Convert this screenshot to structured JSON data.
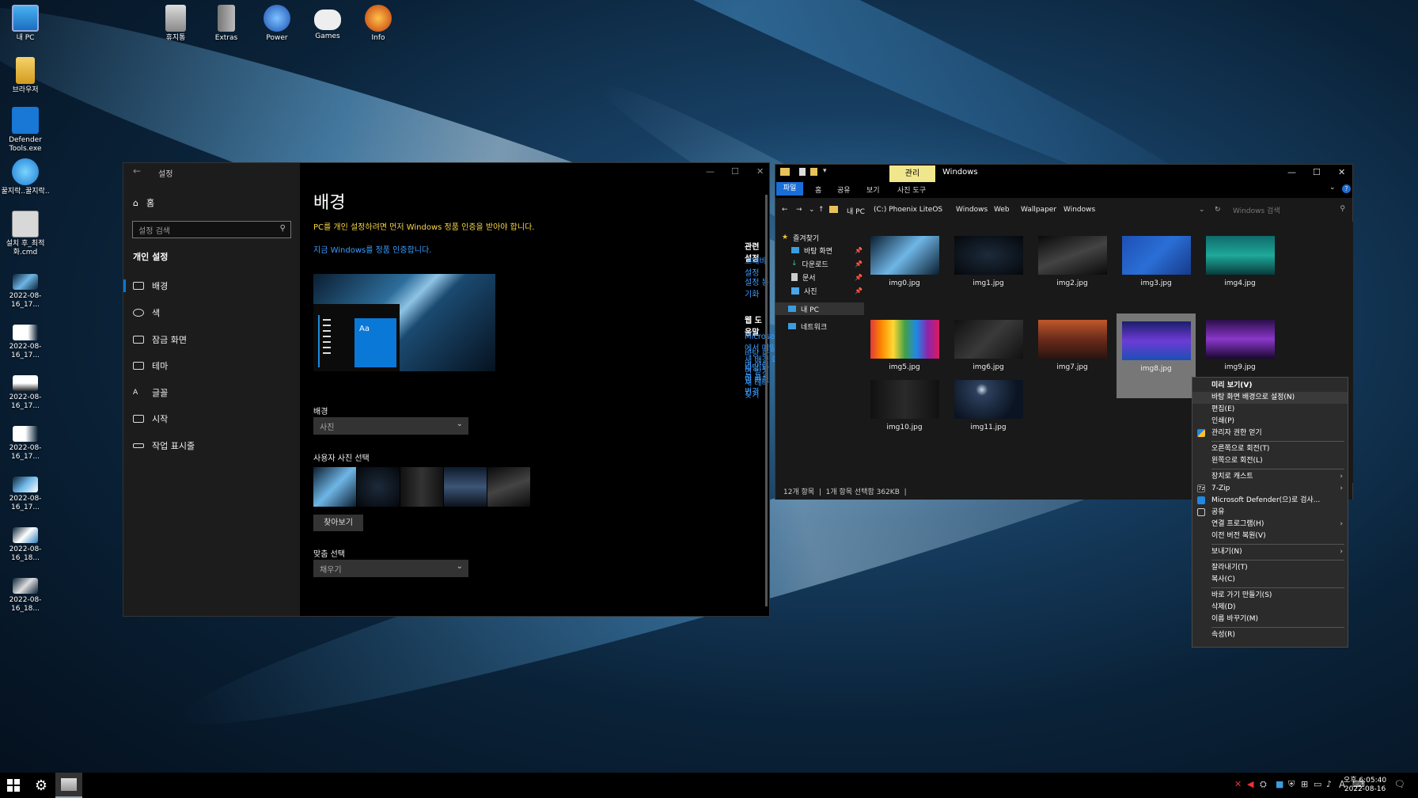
{
  "desktop": {
    "icons": [
      {
        "label": "내 PC"
      },
      {
        "label": "휴지통"
      },
      {
        "label": "Extras"
      },
      {
        "label": "Power"
      },
      {
        "label": "Games"
      },
      {
        "label": "Info"
      },
      {
        "label": "브라우저"
      },
      {
        "label": "Defender Tools.exe"
      },
      {
        "label": "꿀지락..꿀지락.."
      },
      {
        "label": "설치 후_최적화.cmd"
      },
      {
        "label": "2022-08-16_17..."
      },
      {
        "label": "2022-08-16_17..."
      },
      {
        "label": "2022-08-16_17..."
      },
      {
        "label": "2022-08-16_17..."
      },
      {
        "label": "2022-08-16_17..."
      },
      {
        "label": "2022-08-16_18..."
      },
      {
        "label": "2022-08-16_18..."
      }
    ]
  },
  "settings": {
    "title": "설정",
    "home": "홈",
    "search_placeholder": "설정 검색",
    "section": "개인 설정",
    "nav": [
      "배경",
      "색",
      "잠금 화면",
      "테마",
      "글꼴",
      "시작",
      "작업 표시줄"
    ],
    "heading": "배경",
    "warning": "PC를 개인 설정하려면 먼저 Windows 정품 인증을 받아야 합니다.",
    "activate_link": "지금 Windows를 정품 인증합니다.",
    "preview_text": "Aa",
    "bg_label": "배경",
    "bg_value": "사진",
    "choose_label": "사용자 사진 선택",
    "browse": "찾아보기",
    "fit_label": "맞춤 선택",
    "fit_value": "채우기",
    "related_title": "관련 설정",
    "related_links": [
      "고대비 설정",
      "설정 동기화"
    ],
    "help_title": "웹 도움말",
    "help_links": [
      "Microsoft에서 매일 새 배경 화면 받기",
      "바탕 화면 아이콘 표시",
      "바탕 화면 배경 변경",
      "새 테마 찾기"
    ]
  },
  "explorer": {
    "manage": "관리",
    "title": "Windows",
    "ribbon": [
      "파일",
      "홈",
      "공유",
      "보기",
      "사진 도구"
    ],
    "path": [
      "내 PC",
      "(C:) Phoenix LiteOS",
      "Windows",
      "Web",
      "Wallpaper",
      "Windows"
    ],
    "search_placeholder": "Windows 검색",
    "nav": {
      "quick": "즐겨찾기",
      "items": [
        "바탕 화면",
        "다운로드",
        "문서",
        "사진"
      ],
      "pc": "내 PC",
      "network": "네트워크"
    },
    "files": [
      "img0.jpg",
      "img1.jpg",
      "img2.jpg",
      "img3.jpg",
      "img4.jpg",
      "img5.jpg",
      "img6.jpg",
      "img7.jpg",
      "img8.jpg",
      "img9.jpg",
      "img10.jpg",
      "img11.jpg"
    ],
    "status_count": "12개 항목",
    "status_selected": "1개 항목 선택함 362KB"
  },
  "context_menu": [
    "미리 보기(V)",
    "바탕 화면 배경으로 설정(N)",
    "편집(E)",
    "인쇄(P)",
    "관리자 권한 얻기",
    "오른쪽으로 회전(T)",
    "왼쪽으로 회전(L)",
    "장치로 캐스트",
    "7-Zip",
    "Microsoft Defender(으)로 검사...",
    "공유",
    "연결 프로그램(H)",
    "이전 버전 복원(V)",
    "보내기(N)",
    "잘라내기(T)",
    "복사(C)",
    "바로 가기 만들기(S)",
    "삭제(D)",
    "이름 바꾸기(M)",
    "속성(R)"
  ],
  "taskbar": {
    "time": "오후 6:05:40",
    "date": "2022-08-16",
    "ime": "A"
  }
}
